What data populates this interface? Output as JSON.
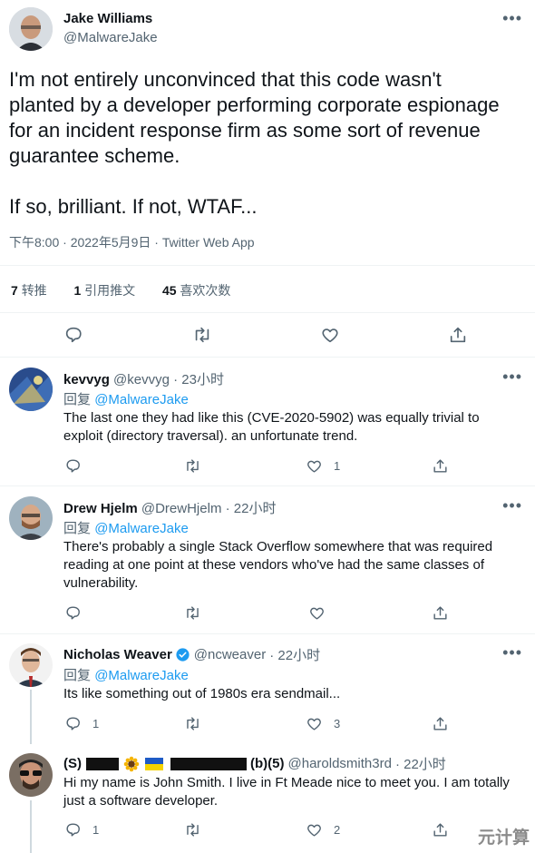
{
  "main": {
    "author": "Jake Williams",
    "handle": "@MalwareJake",
    "text_lines": [
      "I'm not entirely unconvinced that this code wasn't",
      "planted by a developer performing corporate espionage",
      "for an incident response firm as some sort of revenue",
      "guarantee scheme.",
      "If so, brilliant. If not, WTAF..."
    ],
    "meta": "下午8:00 · 2022年5月9日 · Twitter Web App",
    "retweets_count": "7",
    "retweets_label": "转推",
    "quotes_count": "1",
    "quotes_label": "引用推文",
    "likes_count": "45",
    "likes_label": "喜欢次数"
  },
  "replies": [
    {
      "name": "kevvyg",
      "handle": "@kevvyg",
      "time": "· 23小时",
      "reply_prefix": "回复",
      "reply_to": "@MalwareJake",
      "lines": [
        "The last one they had like this (CVE-2020-5902) was equally trivial to",
        "exploit (directory traversal). an unfortunate trend."
      ],
      "like_count": "1"
    },
    {
      "name": "Drew Hjelm",
      "handle": "@DrewHjelm",
      "time": "· 22小时",
      "reply_prefix": "回复",
      "reply_to": "@MalwareJake",
      "lines": [
        "There's probably a single Stack Overflow somewhere that was required",
        "reading at one point at these vendors who've had the same classes of",
        "vulnerability."
      ]
    },
    {
      "name": "Nicholas Weaver",
      "handle": "@ncweaver",
      "time": "· 22小时",
      "reply_prefix": "回复",
      "reply_to": "@MalwareJake",
      "lines": [
        "Its like something out of 1980s era sendmail..."
      ],
      "reply_count": "1",
      "like_count": "3"
    },
    {
      "name_prefix": "(S)",
      "name_suffix": "(b)(5)",
      "handle": "@haroldsmith3rd",
      "time": "· 22小时",
      "lines": [
        "Hi my name is John Smith. I live in Ft Meade nice to meet you. I am totally",
        "just a software developer."
      ],
      "reply_count": "1",
      "like_count": "2"
    }
  ],
  "watermark": "元计算",
  "icons": [
    "more-icon",
    "reply-icon",
    "retweet-icon",
    "like-icon",
    "share-icon",
    "verified-icon",
    "sunflower-icon",
    "ukraine-flag-icon"
  ]
}
